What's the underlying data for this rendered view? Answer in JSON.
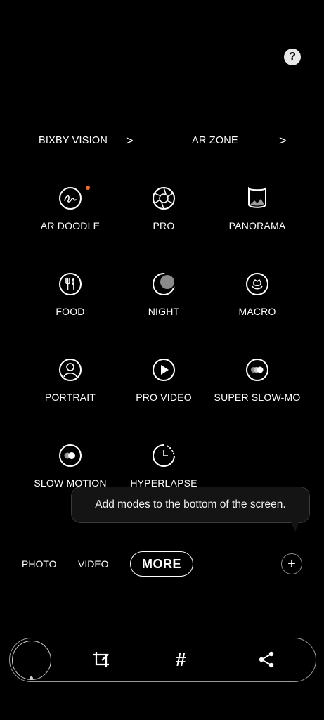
{
  "header": {
    "help_icon": "question-circle-icon",
    "help_glyph": "?"
  },
  "quick_links": [
    {
      "label": "BIXBY VISION",
      "chevron": ">"
    },
    {
      "label": "AR ZONE",
      "chevron": ">"
    }
  ],
  "modes": [
    {
      "label": "AR DOODLE",
      "icon": "ar-doodle-icon",
      "new_badge": true
    },
    {
      "label": "PRO",
      "icon": "aperture-icon"
    },
    {
      "label": "PANORAMA",
      "icon": "panorama-icon"
    },
    {
      "label": "FOOD",
      "icon": "food-icon"
    },
    {
      "label": "NIGHT",
      "icon": "moon-icon"
    },
    {
      "label": "MACRO",
      "icon": "flower-icon"
    },
    {
      "label": "PORTRAIT",
      "icon": "portrait-icon"
    },
    {
      "label": "PRO VIDEO",
      "icon": "play-icon"
    },
    {
      "label": "SUPER SLOW-MO",
      "icon": "super-slow-mo-icon"
    },
    {
      "label": "SLOW MOTION",
      "icon": "slow-motion-icon"
    },
    {
      "label": "HYPERLAPSE",
      "icon": "hyperlapse-icon"
    }
  ],
  "tooltip": {
    "text": "Add modes to the bottom of the screen."
  },
  "bottom_tabs": {
    "photo": "PHOTO",
    "video": "VIDEO",
    "more": "MORE",
    "add_glyph": "+"
  },
  "bottom_bar": {
    "icons": [
      "crop-icon",
      "hashtag-icon",
      "share-icon"
    ],
    "hash_glyph": "#"
  },
  "colors": {
    "background": "#000000",
    "badge": "#f26b2a",
    "text": "#ffffff"
  }
}
